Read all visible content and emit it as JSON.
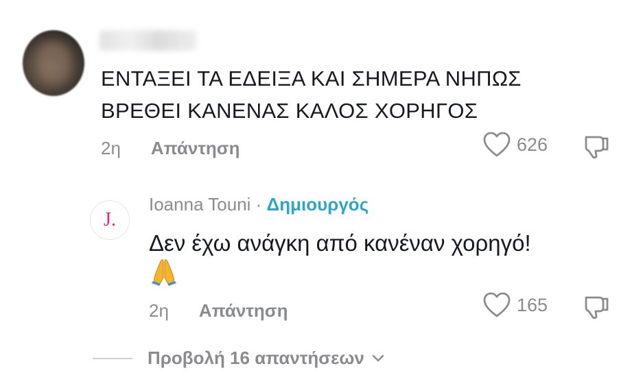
{
  "comment": {
    "text": "ΕΝΤΑΞΕΙ ΤΑ ΕΔΕΙΞΑ ΚΑΙ ΣΗΜΕΡΑ ΝΗΠΩΣ ΒΡΕΘΕΙ ΚΑΝΕΝΑΣ ΚΑΛΟΣ ΧΟΡΗΓΟΣ",
    "time": "2η",
    "reply_label": "Απάντηση",
    "likes": "626"
  },
  "reply": {
    "avatar_letter": "J.",
    "author": "Ioanna Touni",
    "separator": " · ",
    "creator_badge": "Δημιουργός",
    "text": "Δεν έχω ανάγκη από κανέναν χορηγό!",
    "time": "2η",
    "reply_label": "Απάντηση",
    "likes": "165"
  },
  "view_replies": {
    "label": "Προβολή 16 απαντήσεων"
  },
  "colors": {
    "text": "#161823",
    "muted": "#8a8b91",
    "creator": "#2aa6c6",
    "avatar_letter": "#e0218a"
  },
  "icons": {
    "like": "heart-outline-icon",
    "dislike": "thumbs-down-icon",
    "expand": "chevron-down-icon",
    "emoji": "folded-hands-emoji"
  }
}
